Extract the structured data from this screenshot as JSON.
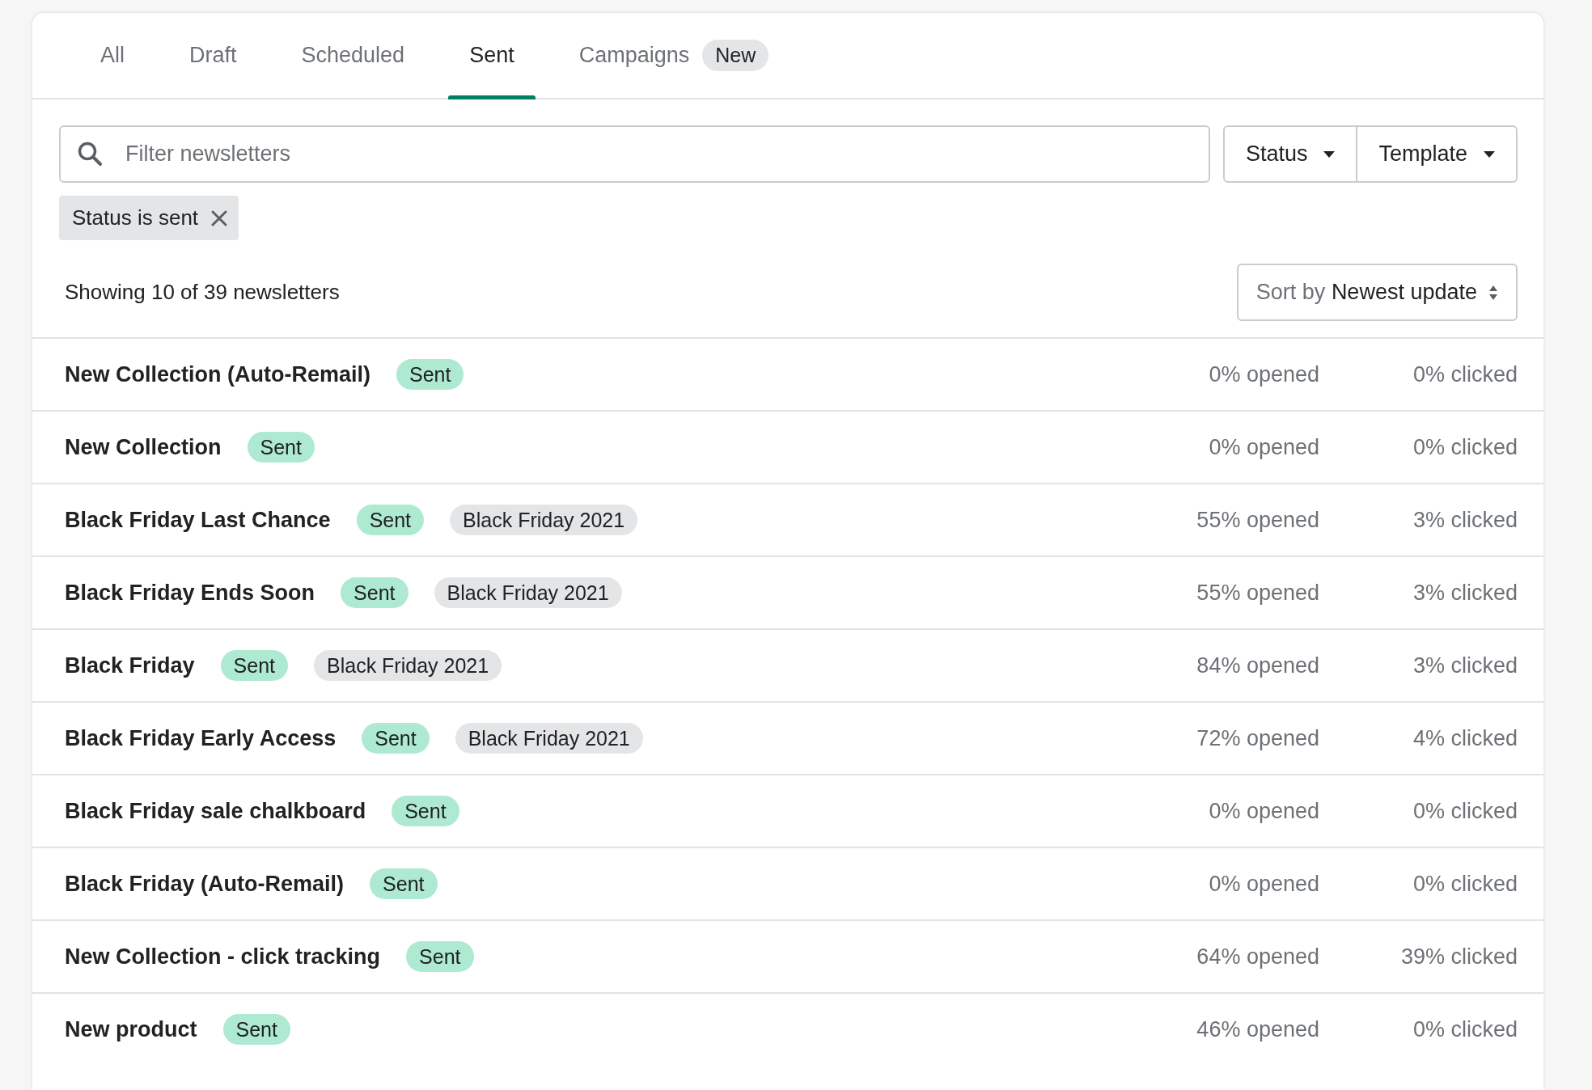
{
  "tabs": [
    {
      "label": "All",
      "selected": false
    },
    {
      "label": "Draft",
      "selected": false
    },
    {
      "label": "Scheduled",
      "selected": false
    },
    {
      "label": "Sent",
      "selected": true
    },
    {
      "label": "Campaigns",
      "selected": false,
      "badge": "New"
    }
  ],
  "filter": {
    "placeholder": "Filter newsletters"
  },
  "filter_buttons": [
    "Status",
    "Template"
  ],
  "applied_filters": [
    "Status is sent"
  ],
  "summary": "Showing 10 of 39 newsletters",
  "sort": {
    "label": "Sort by",
    "value": "Newest update"
  },
  "newsletters": [
    {
      "title": "New Collection (Auto-Remail)",
      "status": "Sent",
      "opened": "0% opened",
      "clicked": "0% clicked"
    },
    {
      "title": "New Collection",
      "status": "Sent",
      "opened": "0% opened",
      "clicked": "0% clicked"
    },
    {
      "title": "Black Friday Last Chance",
      "status": "Sent",
      "campaign": "Black Friday 2021",
      "opened": "55% opened",
      "clicked": "3% clicked"
    },
    {
      "title": "Black Friday Ends Soon",
      "status": "Sent",
      "campaign": "Black Friday 2021",
      "opened": "55% opened",
      "clicked": "3% clicked"
    },
    {
      "title": "Black Friday",
      "status": "Sent",
      "campaign": "Black Friday 2021",
      "opened": "84% opened",
      "clicked": "3% clicked"
    },
    {
      "title": "Black Friday Early Access",
      "status": "Sent",
      "campaign": "Black Friday 2021",
      "opened": "72% opened",
      "clicked": "4% clicked"
    },
    {
      "title": "Black Friday sale chalkboard",
      "status": "Sent",
      "opened": "0% opened",
      "clicked": "0% clicked"
    },
    {
      "title": "Black Friday (Auto-Remail)",
      "status": "Sent",
      "opened": "0% opened",
      "clicked": "0% clicked"
    },
    {
      "title": "New Collection - click tracking",
      "status": "Sent",
      "opened": "64% opened",
      "clicked": "39% clicked"
    },
    {
      "title": "New product",
      "status": "Sent",
      "opened": "46% opened",
      "clicked": "0% clicked"
    }
  ]
}
